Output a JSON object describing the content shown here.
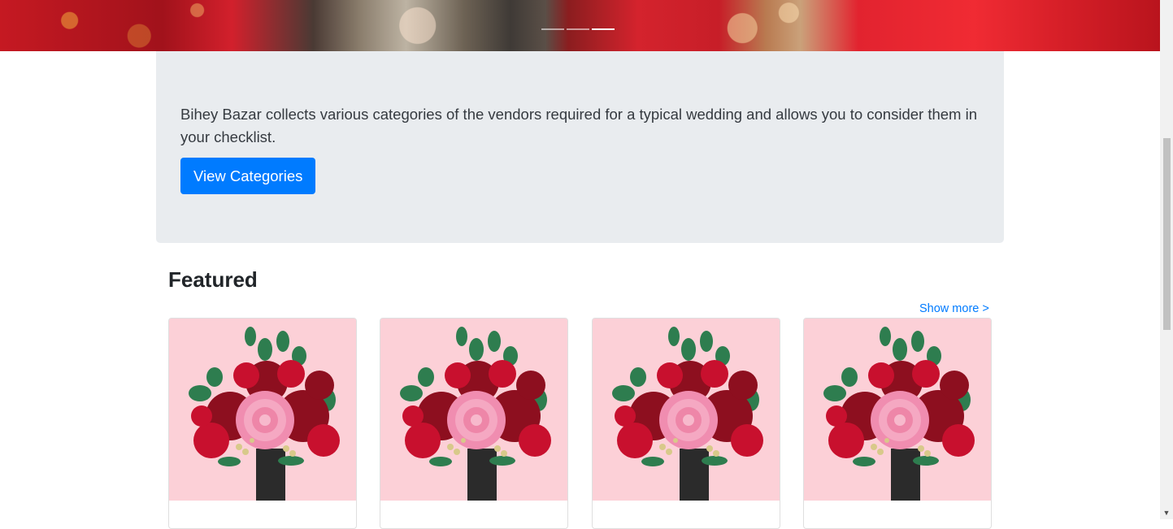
{
  "hero": {
    "indicators": [
      false,
      false,
      true
    ]
  },
  "intro": {
    "lead": "Bihey Bazar collects various categories of the vendors required for a typical wedding and allows you to consider them in your checklist.",
    "button_label": "View Categories"
  },
  "featured": {
    "title": "Featured",
    "show_more": "Show more >",
    "cards": [
      {
        "image": "flower-bouquet"
      },
      {
        "image": "flower-bouquet"
      },
      {
        "image": "flower-bouquet"
      },
      {
        "image": "flower-bouquet"
      }
    ]
  },
  "colors": {
    "primary": "#007bff",
    "jumbotron_bg": "#e9ecef",
    "card_image_bg": "#fcd0d7"
  }
}
